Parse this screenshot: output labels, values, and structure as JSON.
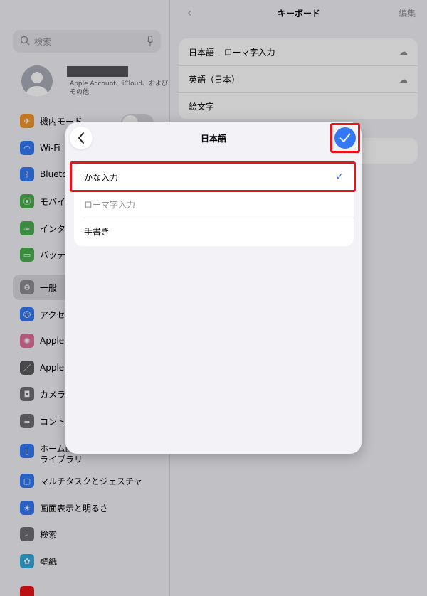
{
  "sidebar": {
    "search_placeholder": "検索",
    "profile_sub": "Apple Account、iCloud、および その他",
    "items": [
      {
        "label": "機内モード",
        "icon": "airplane-icon",
        "color": "#f0962c"
      },
      {
        "label": "Wi-Fi",
        "icon": "wifi-icon",
        "color": "#3478f6"
      },
      {
        "label": "Blueto",
        "icon": "bluetooth-icon",
        "color": "#3478f6"
      },
      {
        "label": "モバイ",
        "icon": "antenna-icon",
        "color": "#4cb04f"
      },
      {
        "label": "インタ-",
        "icon": "link-icon",
        "color": "#4cb04f"
      },
      {
        "label": "バッテ",
        "icon": "battery-icon",
        "color": "#4cb04f"
      },
      {
        "label": "一般",
        "icon": "gear-icon",
        "color": "#8e8e93"
      },
      {
        "label": "アクセ",
        "icon": "accessibility-icon",
        "color": "#3478f6"
      },
      {
        "label": "Apple I",
        "icon": "intelligence-icon",
        "color": "#e0709c"
      },
      {
        "label": "Apple I",
        "icon": "pencil-icon",
        "color": "#5a5a5e"
      },
      {
        "label": "カメラ",
        "icon": "camera-icon",
        "color": "#6e6e73"
      },
      {
        "label": "コントI",
        "icon": "control-center-icon",
        "color": "#6e6e73"
      },
      {
        "label": "ホーム画\nライブラリ",
        "icon": "home-screen-icon",
        "color": "#3478f6"
      },
      {
        "label": "マルチタスクとジェスチャ",
        "icon": "multitask-icon",
        "color": "#3478f6"
      },
      {
        "label": "画面表示と明るさ",
        "icon": "brightness-icon",
        "color": "#3478f6"
      },
      {
        "label": "検索",
        "icon": "search-icon",
        "color": "#6e6e73"
      },
      {
        "label": "壁紙",
        "icon": "wallpaper-icon",
        "color": "#35aadc"
      }
    ]
  },
  "detail": {
    "title": "キーボード",
    "edit": "編集",
    "keyboards": [
      "日本語 – ローマ字入力",
      "英語（日本）",
      "絵文字"
    ]
  },
  "sheet": {
    "title": "日本語",
    "options": [
      {
        "label": "かな入力",
        "checked": true
      },
      {
        "label": "ローマ字入力",
        "checked": false
      },
      {
        "label": "手書き",
        "checked": false
      }
    ],
    "checkmark": "✓",
    "highlight_color": "#e8141b",
    "accent": "#3478f6"
  }
}
